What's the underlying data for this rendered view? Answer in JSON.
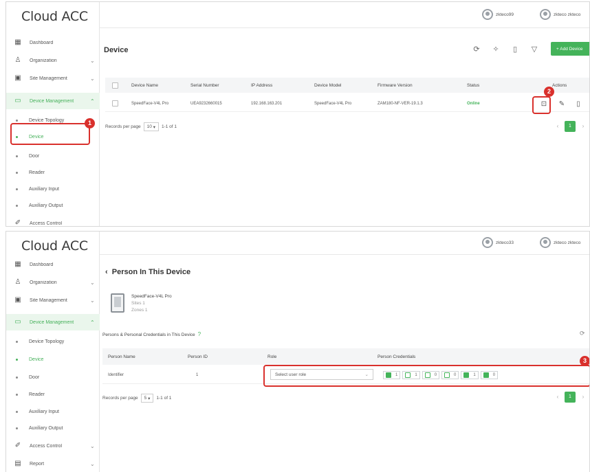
{
  "app_title": "Cloud ACC",
  "annotation_colors": {
    "callout": "#d9302c",
    "accent": "#44b35a"
  },
  "top": {
    "users": [
      "zkteco99",
      "zkteco zkteco"
    ],
    "sidebar": [
      {
        "label": "Dashboard",
        "icon": "dashboard-icon"
      },
      {
        "label": "Organization",
        "icon": "organization-icon"
      },
      {
        "label": "Site Management",
        "icon": "site-icon"
      },
      {
        "label": "Device Management",
        "icon": "device-management-icon"
      }
    ],
    "sidebar_sub": [
      "Device Topology",
      "Device",
      "Door",
      "Reader",
      "Auxiliary Input",
      "Auxiliary Output"
    ],
    "sidebar_more": {
      "label": "Access Control",
      "icon": "access-control-icon"
    },
    "title": "Device",
    "add_button": "+ Add Device",
    "columns": [
      "Device Name",
      "Serial Number",
      "IP Address",
      "Device Model",
      "Firmware Version",
      "Status",
      "Actions"
    ],
    "row": {
      "name": "SpeedFace-V4L Pro",
      "serial": "UEA9232660015",
      "ip": "192.168.163.201",
      "model": "SpeedFace-V4L Pro",
      "firmware": "ZAM180-NF-VER-19.1.3",
      "status": "Online"
    },
    "pagination": {
      "label": "Records per page",
      "per_page": "10",
      "range": "1-1 of 1",
      "current_page": "1"
    },
    "badges": [
      "1",
      "2"
    ]
  },
  "bottom": {
    "users": [
      "zkteco33",
      "zkteco zkteco"
    ],
    "sidebar": [
      {
        "label": "Dashboard",
        "icon": "dashboard-icon"
      },
      {
        "label": "Organization",
        "icon": "organization-icon"
      },
      {
        "label": "Site Management",
        "icon": "site-icon"
      },
      {
        "label": "Device Management",
        "icon": "device-management-icon"
      }
    ],
    "sidebar_sub": [
      "Device Topology",
      "Device",
      "Door",
      "Reader",
      "Auxiliary Input",
      "Auxiliary Output"
    ],
    "sidebar_more": [
      {
        "label": "Access Control",
        "icon": "access-control-icon"
      },
      {
        "label": "Report",
        "icon": "report-icon"
      }
    ],
    "back_title": "Person In This Device",
    "device": {
      "name": "SpeedFace-V4L Pro",
      "line2": "Sites 1",
      "line3": "Zones 1"
    },
    "section_label": "Persons & Personal Credentials in This Device",
    "columns": [
      "Person Name",
      "Person ID",
      "Role",
      "Person Credentials"
    ],
    "row": {
      "name": "Identifier",
      "id": "1",
      "role_placeholder": "Select user role"
    },
    "credentials": [
      "1",
      "1",
      "0",
      "0",
      "1",
      "0"
    ],
    "pagination": {
      "label": "Records per page",
      "per_page": "5",
      "range": "1-1 of 1",
      "current_page": "1"
    },
    "badge": "3"
  }
}
